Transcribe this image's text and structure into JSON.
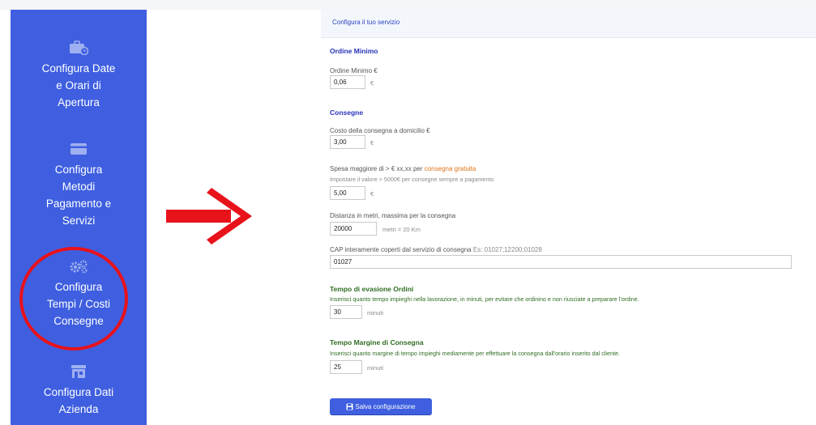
{
  "sidebar": {
    "items": [
      {
        "label": "Configura Date\ne Orari di\nApertura",
        "icon": "briefcase-clock-icon"
      },
      {
        "label": "Configura\nMetodi\nPagamento e\nServizi",
        "icon": "credit-card-icon"
      },
      {
        "label": "Configura\nTempi / Costi\nConsegne",
        "icon": "gears-icon"
      },
      {
        "label": "Configura Dati\nAzienda",
        "icon": "store-icon"
      }
    ]
  },
  "annotations": {
    "highlight_color": "#e8121b",
    "arrow_color": "#e8121b"
  },
  "header": {
    "title": "Configura il tuo servizio"
  },
  "form": {
    "ordine": {
      "section_title": "Ordine Minimo",
      "label": "Ordine Minimo €",
      "value": "0,06",
      "unit": "€"
    },
    "consegne": {
      "section_title": "Consegne",
      "costo_label": "Costo della consegna a domicilio €",
      "costo_value": "3,00",
      "costo_unit": "€",
      "spesa_label_prefix": "Spesa maggiore di > € xx,xx per ",
      "spesa_label_highlight": "consegna gratuita",
      "spesa_help": "Impostare il valore > 5000€ per consegne sempre a pagamento",
      "spesa_value": "5,00",
      "spesa_unit": "€",
      "distanza_label": "Distanza in metri, massima per la consegna",
      "distanza_value": "20000",
      "distanza_unit": "metri = 20 Km",
      "cap_label": "CAP interamente coperti dal servizio di consegna",
      "cap_example": "Es: 01027;12200;01028",
      "cap_value": "01027"
    },
    "evasione": {
      "section_title": "Tempo di evasione Ordini",
      "help": "Inserisci quanto tempo impieghi nella lavorazione, in minuti, per evitare che ordinino e non riusciate a preparare l'ordine.",
      "value": "30",
      "unit": "minuti"
    },
    "margine": {
      "section_title": "Tempo Margine di Consegna",
      "help": "Inserisci quanto margine di tempo impieghi mediamente per effettuare la consegna dall'orario inserito dal cliente.",
      "value": "25",
      "unit": "minuti"
    },
    "save_label": "Salva configurazione"
  }
}
